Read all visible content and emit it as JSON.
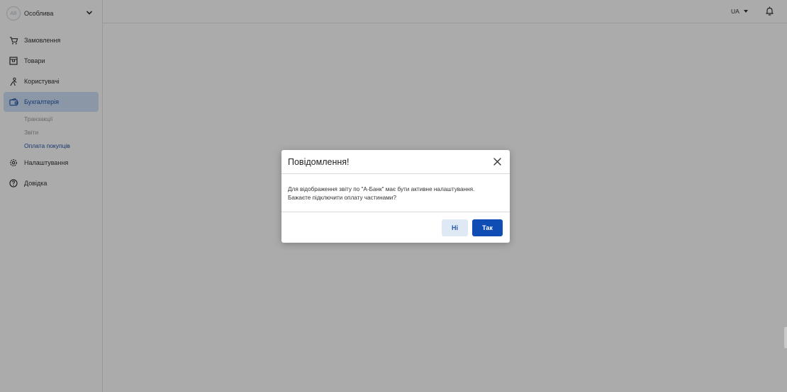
{
  "account": {
    "avatar_initials": "AB",
    "name": "Особлива"
  },
  "sidebar": {
    "items": [
      {
        "label": "Замовлення",
        "icon": "cart-icon"
      },
      {
        "label": "Товари",
        "icon": "box-icon"
      },
      {
        "label": "Користувачі",
        "icon": "users-icon"
      },
      {
        "label": "Бухгалтерія",
        "icon": "wallet-icon",
        "active": true
      },
      {
        "label": "Налаштування",
        "icon": "gear-icon"
      },
      {
        "label": "Довідка",
        "icon": "help-icon"
      }
    ],
    "subitems": [
      {
        "label": "Транзакції"
      },
      {
        "label": "Звіти"
      },
      {
        "label": "Оплата покупців",
        "active": true
      }
    ]
  },
  "header": {
    "language": "UA"
  },
  "modal": {
    "title": "Повідомлення!",
    "body_line1": "Для відображення звіту по \"А-Банк\" має бути активне налаштування.",
    "body_line2": "Бажаєте підключити оплату частинами?",
    "no_label": "Ні",
    "yes_label": "Так"
  },
  "colors": {
    "accent": "#0f4db5",
    "active_bg": "#cfe0fa",
    "overlay": "rgba(0,0,0,0.33)"
  }
}
